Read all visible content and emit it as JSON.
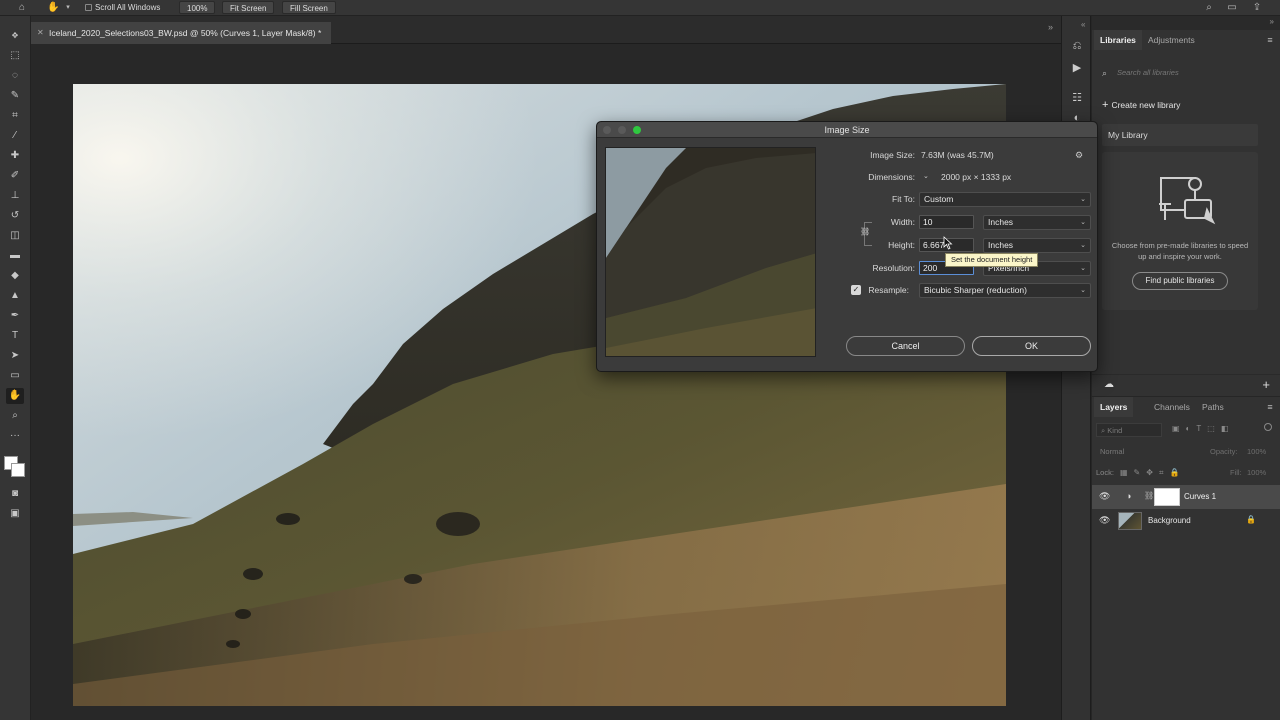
{
  "options_bar": {
    "scroll_all_windows": "Scroll All Windows",
    "zoom_100": "100%",
    "fit_screen": "Fit Screen",
    "fill_screen": "Fill Screen"
  },
  "document": {
    "tab_title": "Iceland_2020_Selections03_BW.psd @ 50% (Curves 1, Layer Mask/8) *"
  },
  "dialog": {
    "title": "Image Size",
    "image_size_label": "Image Size:",
    "image_size_value": "7.63M (was 45.7M)",
    "dimensions_label": "Dimensions:",
    "dimensions_value": "2000 px  ×  1333 px",
    "fit_to_label": "Fit To:",
    "fit_to_value": "Custom",
    "width_label": "Width:",
    "width_value": "10",
    "width_unit": "Inches",
    "height_label": "Height:",
    "height_value": "6.667",
    "height_unit": "Inches",
    "resolution_label": "Resolution:",
    "resolution_value": "200",
    "resolution_unit": "Pixels/Inch",
    "resample_label": "Resample:",
    "resample_value": "Bicubic Sharper (reduction)",
    "resample_checked": true,
    "cancel": "Cancel",
    "ok": "OK",
    "tooltip": "Set the document height"
  },
  "libraries": {
    "tab_libraries": "Libraries",
    "tab_adjustments": "Adjustments",
    "search_placeholder": "Search all libraries",
    "create_new": "Create new library",
    "my_library": "My Library",
    "promo_text": "Choose from pre-made libraries to speed up and inspire your work.",
    "find_public": "Find public libraries"
  },
  "layers": {
    "tab_layers": "Layers",
    "tab_channels": "Channels",
    "tab_paths": "Paths",
    "kind": "Kind",
    "blend_mode": "Normal",
    "opacity_label": "Opacity:",
    "opacity_value": "100%",
    "lock_label": "Lock:",
    "fill_label": "Fill:",
    "fill_value": "100%",
    "items": [
      {
        "name": "Curves 1"
      },
      {
        "name": "Background"
      }
    ]
  },
  "colors": {
    "accent_ok_border": "#a9a9a9",
    "tooltip_bg": "#fbf6c9",
    "traffic_green": "#2fc840"
  }
}
